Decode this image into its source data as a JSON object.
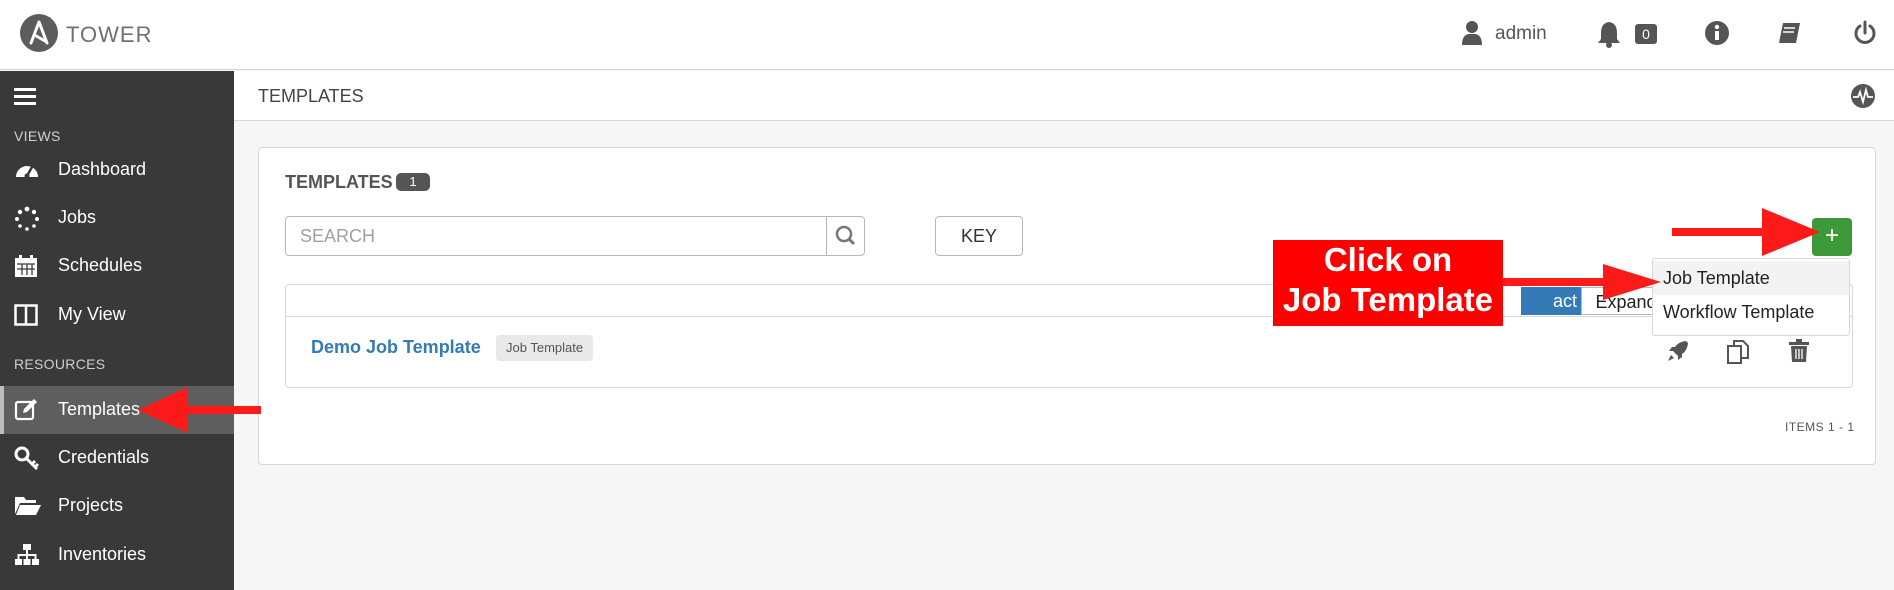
{
  "app": {
    "brand": "TOWER"
  },
  "topbar": {
    "user_label": "admin",
    "notification_count": "0"
  },
  "sidebar": {
    "sections": {
      "views": "VIEWS",
      "resources": "RESOURCES"
    },
    "items": [
      {
        "label": "Dashboard",
        "icon": "dashboard-icon"
      },
      {
        "label": "Jobs",
        "icon": "jobs-spinner-icon"
      },
      {
        "label": "Schedules",
        "icon": "calendar-icon"
      },
      {
        "label": "My View",
        "icon": "columns-icon"
      },
      {
        "label": "Templates",
        "icon": "edit-icon",
        "active": true
      },
      {
        "label": "Credentials",
        "icon": "key-icon"
      },
      {
        "label": "Projects",
        "icon": "folder-open-icon"
      },
      {
        "label": "Inventories",
        "icon": "sitemap-icon"
      }
    ]
  },
  "page": {
    "title": "TEMPLATES"
  },
  "panel": {
    "title": "TEMPLATES",
    "count": "1",
    "search_placeholder": "SEARCH",
    "key_label": "KEY",
    "add_label": "+",
    "view_toggle": {
      "compact": "act",
      "expanded": "Expanded"
    },
    "rows": [
      {
        "name": "Demo Job Template",
        "type": "Job Template"
      }
    ],
    "items_label": "ITEMS  1 - 1"
  },
  "dropdown": {
    "items": [
      "Job Template",
      "Workflow Template"
    ]
  },
  "annotation": {
    "line1": "Click on",
    "line2": "Job Template"
  },
  "colors": {
    "sidebar": "#393939",
    "accent_green": "#3c9a3a",
    "link_blue": "#337ab7",
    "annotation_red": "#ff0000"
  }
}
